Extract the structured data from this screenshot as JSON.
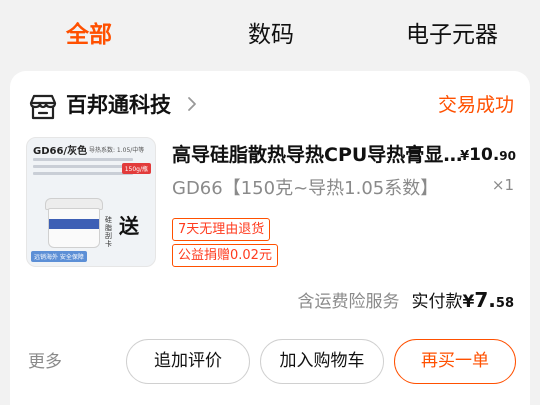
{
  "tabs": [
    {
      "label": "全部",
      "active": true
    },
    {
      "label": "数码",
      "active": false
    },
    {
      "label": "电子元器",
      "active": false
    }
  ],
  "colors": {
    "accent": "#ff5000"
  },
  "order": {
    "shop": {
      "name": "百邦通科技",
      "icon": "shop-icon"
    },
    "status": "交易成功",
    "item": {
      "thumbnail": {
        "label": "GD66/灰色",
        "spec": "导热系数: 1.05/中等",
        "tag": "150g/瓶",
        "send": "送",
        "small_text": "硅脂刮卡",
        "bottom_tag": "远销海外 安全保障"
      },
      "title": "高导硅脂散热导热CPU导热膏显卡硅脂",
      "price": {
        "symbol": "¥",
        "integer": "10.",
        "decimal": "90"
      },
      "sku": "GD66【150克~导热1.05系数】",
      "quantity": "×1",
      "badges": {
        "return": "7天无理由退货",
        "charity": "公益捐赠0.02元"
      }
    },
    "summary": {
      "insurance": "含运费险服务",
      "paid_label": "实付款",
      "paid": {
        "symbol": "¥",
        "integer": "7.",
        "decimal": "58"
      }
    },
    "actions": {
      "more": "更多",
      "review": "追加评价",
      "add_to_cart": "加入购物车",
      "rebuy": "再买一单"
    }
  }
}
